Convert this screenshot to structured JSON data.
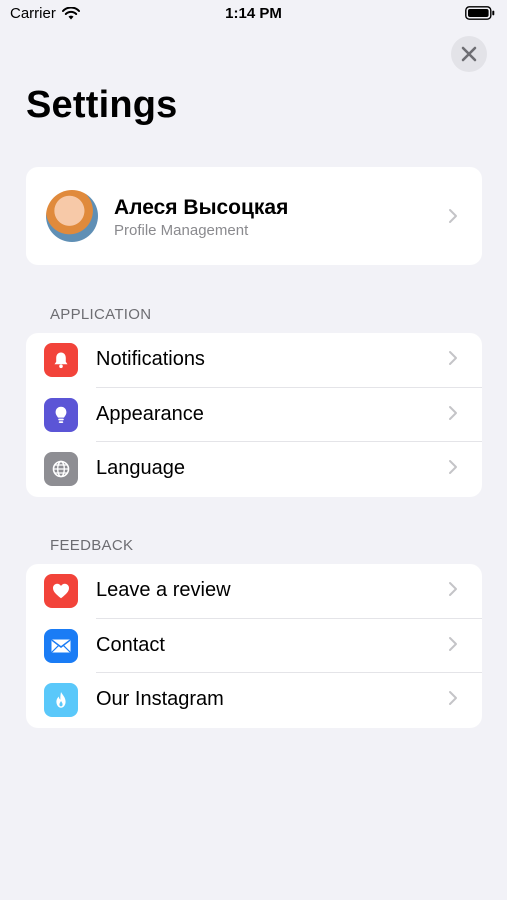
{
  "status_bar": {
    "carrier": "Carrier",
    "time": "1:14 PM"
  },
  "page": {
    "title": "Settings"
  },
  "profile": {
    "name": "Алеся Высоцкая",
    "subtitle": "Profile Management"
  },
  "sections": {
    "application": {
      "header": "APPLICATION",
      "items": [
        {
          "label": "Notifications",
          "icon": "bell-icon",
          "color": "#f2433a"
        },
        {
          "label": "Appearance",
          "icon": "lightbulb-icon",
          "color": "#5b55d6"
        },
        {
          "label": "Language",
          "icon": "globe-icon",
          "color": "#8e8e93"
        }
      ]
    },
    "feedback": {
      "header": "FEEDBACK",
      "items": [
        {
          "label": "Leave a review",
          "icon": "heart-icon",
          "color": "#f2433a"
        },
        {
          "label": "Contact",
          "icon": "mail-icon",
          "color": "#1a7cf5"
        },
        {
          "label": "Our Instagram",
          "icon": "flame-icon",
          "color": "#5ac8fa"
        }
      ]
    }
  },
  "colors": {
    "background": "#f2f2f7",
    "card": "#ffffff",
    "secondary_text": "#8a8a8e"
  }
}
